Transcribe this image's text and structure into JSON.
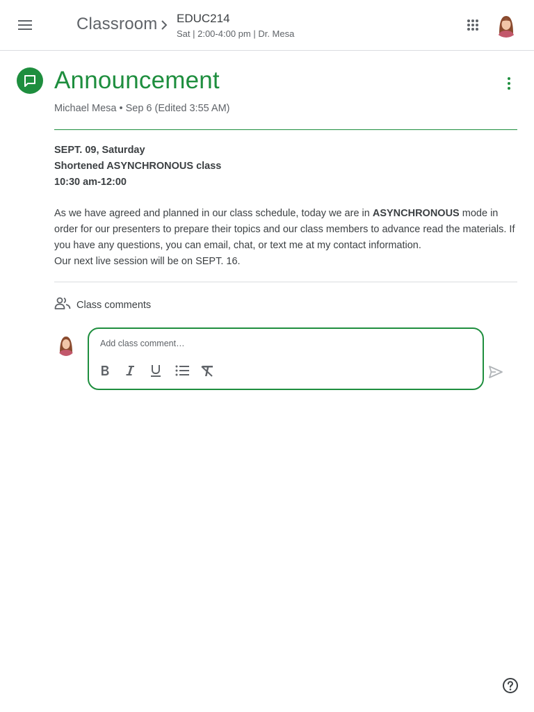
{
  "header": {
    "app_title": "Classroom",
    "course_name": "EDUC214",
    "course_subtitle": "Sat | 2:00-4:00 pm | Dr. Mesa",
    "menu_icon": "hamburger-menu-icon",
    "apps_icon": "apps-grid-icon",
    "breadcrumb_icon": "chevron-right-icon"
  },
  "post": {
    "type_label": "Announcement",
    "icon": "announcement-chat-icon",
    "meta": "Michael Mesa • Sep 6 (Edited 3:55 AM)",
    "headline_lines": [
      "SEPT. 09, Saturday",
      "Shortened ASYNCHRONOUS class",
      "10:30 am-12:00"
    ],
    "paragraph": {
      "before_bold": "As we have agreed and planned in our class schedule, today we are in ",
      "bold": "ASYNCHRONOUS",
      "after_bold": " mode in order for our presenters to prepare their topics and our class members to advance read the materials. If you have any questions, you can email, chat, or text me at my contact information.",
      "closing_line": "Our next live session will be on SEPT. 16."
    }
  },
  "comments": {
    "label": "Class comments",
    "icon": "people-icon",
    "placeholder": "Add class comment…",
    "value": "",
    "format_buttons": [
      "bold-icon",
      "italic-icon",
      "underline-icon",
      "bulleted-list-icon",
      "clear-formatting-icon"
    ],
    "send_icon": "send-icon"
  },
  "footer": {
    "help_icon": "help-icon"
  },
  "colors": {
    "accent": "#1e8e3e",
    "text": "#3c4043",
    "secondary_text": "#5f6368",
    "divider": "#dadce0"
  }
}
